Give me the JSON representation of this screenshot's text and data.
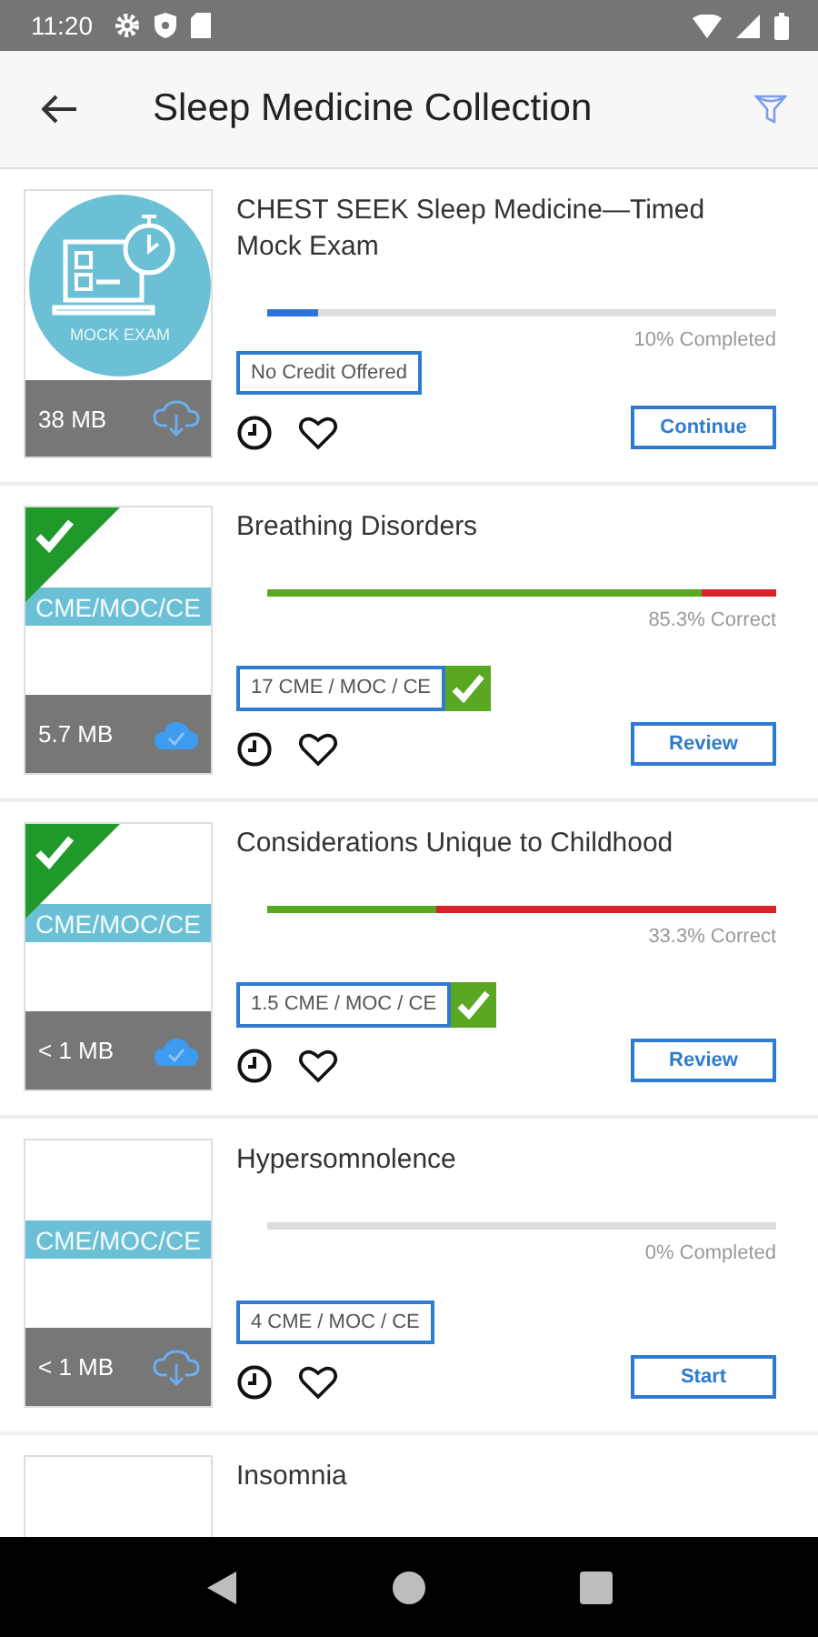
{
  "status_bar": {
    "time": "11:20"
  },
  "app_bar": {
    "title": "Sleep Medicine Collection"
  },
  "items": [
    {
      "title": "CHEST SEEK Sleep Medicine—Timed Mock Exam",
      "thumbnail": {
        "kind": "mock_exam",
        "caption": "MOCK EXAM",
        "earned": false,
        "size": "38 MB",
        "downloaded": false
      },
      "progress": {
        "kind": "completed",
        "level": 0.1,
        "label": "10% Completed"
      },
      "credit": {
        "label": "No Credit Offered",
        "earned": false
      },
      "button": "Continue"
    },
    {
      "title": "Breathing Disorders",
      "thumbnail": {
        "kind": "cme",
        "badge": "CME/MOC/CE",
        "earned": true,
        "size": "5.7 MB",
        "downloaded": true
      },
      "progress": {
        "kind": "correct",
        "level": 0.853,
        "label": "85.3% Correct"
      },
      "credit": {
        "label": "17 CME / MOC / CE",
        "earned": true
      },
      "button": "Review"
    },
    {
      "title": "Considerations Unique to Childhood",
      "thumbnail": {
        "kind": "cme",
        "badge": "CME/MOC/CE",
        "earned": true,
        "size": "< 1 MB",
        "downloaded": true
      },
      "progress": {
        "kind": "correct",
        "level": 0.333,
        "label": "33.3% Correct"
      },
      "credit": {
        "label": "1.5 CME / MOC / CE",
        "earned": true
      },
      "button": "Review"
    },
    {
      "title": "Hypersomnolence",
      "thumbnail": {
        "kind": "cme",
        "badge": "CME/MOC/CE",
        "earned": false,
        "size": "< 1 MB",
        "downloaded": false
      },
      "progress": {
        "kind": "completed",
        "level": 0,
        "label": "0% Completed"
      },
      "credit": {
        "label": "4 CME / MOC / CE",
        "earned": false
      },
      "button": "Start"
    },
    {
      "title": "Insomnia",
      "thumbnail": {
        "kind": "cme",
        "earned": false
      }
    }
  ]
}
